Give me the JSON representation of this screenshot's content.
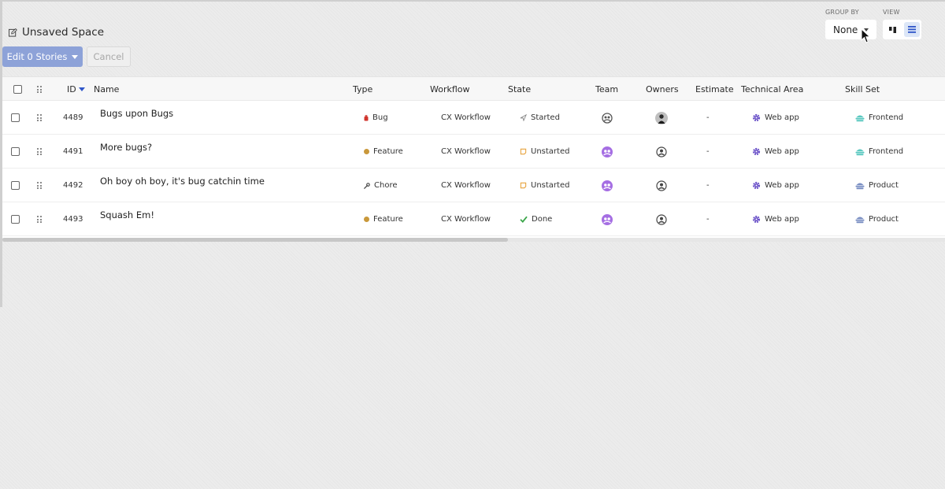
{
  "header": {
    "title": "Unsaved Space"
  },
  "actions": {
    "edit_label": "Edit 0 Stories",
    "cancel_label": "Cancel"
  },
  "controls": {
    "group_by_label": "GROUP BY",
    "group_by_value": "None",
    "view_label": "VIEW",
    "view_options": [
      "kanban-view-icon",
      "list-view-icon"
    ],
    "active_view": "list-view-icon"
  },
  "colors": {
    "primary_button": "#8da2d8",
    "accent_blue": "#2f56c9",
    "feature_dot": "#c9983b",
    "bug_red": "#d0342c",
    "team_purple": "#a56ee3",
    "done_green": "#3ba64a",
    "unstarted_orange": "#e8a33d",
    "settings_purple": "#6b52c8",
    "frontend_teal": "#5ac8c0",
    "product_blue": "#7a8fc3"
  },
  "table": {
    "columns": {
      "id": "ID",
      "name": "Name",
      "type": "Type",
      "workflow": "Workflow",
      "state": "State",
      "team": "Team",
      "owners": "Owners",
      "estimate": "Estimate",
      "technical_area": "Technical Area",
      "skill_set": "Skill Set"
    },
    "sort_column": "id",
    "rows": [
      {
        "id": "4489",
        "name": "Bugs upon Bugs",
        "type": "Bug",
        "type_icon": "bug-icon",
        "workflow": "CX Workflow",
        "state": "Started",
        "state_icon": "started-icon",
        "team_icon": "team-icon-gray",
        "owner_icon": "owner-avatar",
        "estimate": "-",
        "technical_area": "Web app",
        "skill_set": "Frontend",
        "skill_icon": "frontend-icon"
      },
      {
        "id": "4491",
        "name": "More bugs?",
        "type": "Feature",
        "type_icon": "feature-dot-icon",
        "workflow": "CX Workflow",
        "state": "Unstarted",
        "state_icon": "unstarted-icon",
        "team_icon": "team-icon-purple",
        "owner_icon": "user-circle-icon",
        "estimate": "-",
        "technical_area": "Web app",
        "skill_set": "Frontend",
        "skill_icon": "frontend-icon"
      },
      {
        "id": "4492",
        "name": "Oh boy oh boy, it's bug catchin time",
        "type": "Chore",
        "type_icon": "wrench-icon",
        "workflow": "CX Workflow",
        "state": "Unstarted",
        "state_icon": "unstarted-icon",
        "team_icon": "team-icon-purple",
        "owner_icon": "user-circle-icon",
        "estimate": "-",
        "technical_area": "Web app",
        "skill_set": "Product",
        "skill_icon": "product-icon"
      },
      {
        "id": "4493",
        "name": "Squash Em!",
        "type": "Feature",
        "type_icon": "feature-dot-icon",
        "workflow": "CX Workflow",
        "state": "Done",
        "state_icon": "checkmark-icon",
        "team_icon": "team-icon-purple",
        "owner_icon": "user-circle-icon",
        "estimate": "-",
        "technical_area": "Web app",
        "skill_set": "Product",
        "skill_icon": "product-icon"
      }
    ]
  }
}
